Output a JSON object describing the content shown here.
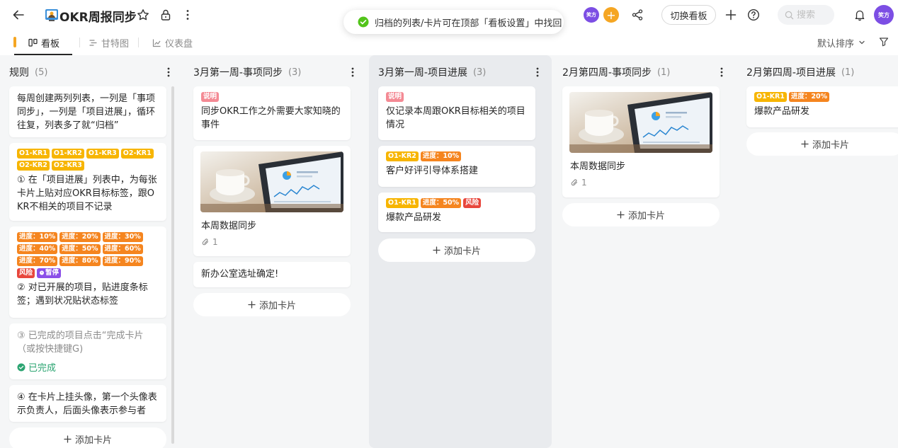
{
  "header": {
    "project_title": "OKR周报同步",
    "switch_board_label": "切换看板",
    "search_placeholder": "搜索",
    "member_avatar_text": "笑方",
    "my_avatar_text": "笑方",
    "add_member_label": "+"
  },
  "toast": {
    "text": "归档的列表/卡片可在顶部「看板设置」中找回"
  },
  "views": {
    "kanban": "看板",
    "gantt": "甘特图",
    "dashboard": "仪表盘",
    "sort_label": "默认排序"
  },
  "add_card_label": "添加卡片",
  "columns": [
    {
      "title": "规则",
      "count": "(5)",
      "cards": [
        {
          "text": "每周创建两列列表，一列是「事项同步」，一列是「项目进展」，循环往复，列表多了就“归档”"
        },
        {
          "tags": [
            "O1-KR1",
            "O1-KR2",
            "O1-KR3",
            "O2-KR1",
            "O2-KR2",
            "O2-KR3"
          ],
          "text": "① 在「项目进展」列表中，为每张卡片上贴对应OKR目标标签，跟OKR不相关的项目不记录"
        },
        {
          "tags": [
            "进度：10%",
            "进度：20%",
            "进度：30%",
            "进度：40%",
            "进度：50%",
            "进度：60%",
            "进度：70%",
            "进度：80%",
            "进度：90%",
            "风险",
            "暂停"
          ],
          "text": "② 对已开展的项目，贴进度条标签；遇到状况贴状态标签"
        },
        {
          "text": "③ 已完成的项目点击“完成卡片（或按快捷键G)",
          "done_label": "已完成"
        },
        {
          "text": "④ 在卡片上挂头像，第一个头像表示负责人，后面头像表示参与者"
        }
      ]
    },
    {
      "title": "3月第一周-事项同步",
      "count": "(3)",
      "cards": [
        {
          "tags": [
            "说明"
          ],
          "text": "同步OKR工作之外需要大家知晓的事件"
        },
        {
          "text": "本周数据同步",
          "attach_count": "1"
        },
        {
          "text": "新办公室选址确定!"
        }
      ]
    },
    {
      "title": "3月第一周-项目进展",
      "count": "(3)",
      "cards": [
        {
          "tags": [
            "说明"
          ],
          "text": "仅记录本周跟OKR目标相关的项目情况"
        },
        {
          "tags": [
            "O1-KR2",
            "进度：10%"
          ],
          "text": "客户好评引导体系搭建"
        },
        {
          "tags": [
            "O1-KR1",
            "进度：50%",
            "风险"
          ],
          "text": "爆款产品研发"
        }
      ]
    },
    {
      "title": "2月第四周-事项同步",
      "count": "(1)",
      "cards": [
        {
          "text": "本周数据同步",
          "attach_count": "1"
        }
      ]
    },
    {
      "title": "2月第四周-项目进展",
      "count": "(1)",
      "cards": [
        {
          "tags": [
            "O1-KR1",
            "进度：20%"
          ],
          "text": "爆款产品研发"
        }
      ]
    }
  ]
}
